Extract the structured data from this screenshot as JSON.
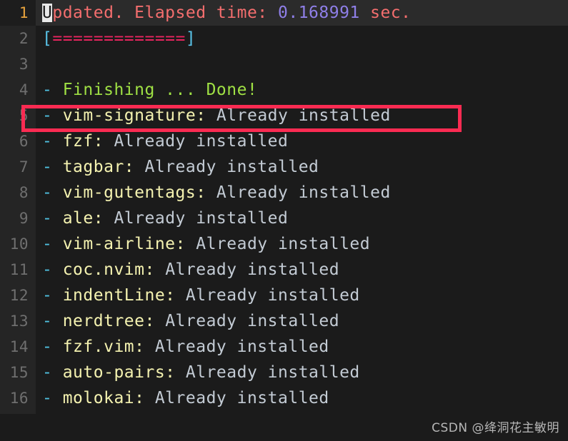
{
  "terminal": {
    "background_color": "#1b1b1b",
    "gutter_color": "#252525",
    "current_line_color": "#2b2b2b"
  },
  "colors": {
    "message": "#f46e6e",
    "number": "#8f7fe8",
    "bracket": "#59c3e8",
    "equals": "#e8255f",
    "dash": "#4fc1e0",
    "done": "#9fe044",
    "plugin": "#f4f2b0",
    "status": "#c3cbd4",
    "line_number": "#6f6f6f",
    "current_line_number": "#e8a33d",
    "cursor": "#e9e9e9",
    "highlight_box": "#fb2b52"
  },
  "lines": [
    {
      "number": "1",
      "current": true,
      "segments": [
        {
          "text": "U",
          "style": "cursor"
        },
        {
          "text": "pdated. Elapsed time: ",
          "style": "c-msg"
        },
        {
          "text": "0.168991",
          "style": "c-num"
        },
        {
          "text": " sec.",
          "style": "c-msg"
        }
      ]
    },
    {
      "number": "2",
      "current": false,
      "segments": [
        {
          "text": "[",
          "style": "c-bracket"
        },
        {
          "text": "=============",
          "style": "c-eq"
        },
        {
          "text": "]",
          "style": "c-bracket"
        }
      ]
    },
    {
      "number": "3",
      "current": false,
      "segments": []
    },
    {
      "number": "4",
      "current": false,
      "segments": [
        {
          "text": "-",
          "style": "c-dash"
        },
        {
          "text": " Finishing ... Done!",
          "style": "c-done"
        }
      ]
    },
    {
      "number": "5",
      "current": false,
      "segments": [
        {
          "text": "-",
          "style": "c-dash"
        },
        {
          "text": " vim-signature:",
          "style": "c-plugin"
        },
        {
          "text": " Already installed",
          "style": "c-status"
        }
      ]
    },
    {
      "number": "6",
      "current": false,
      "segments": [
        {
          "text": "-",
          "style": "c-dash"
        },
        {
          "text": " fzf:",
          "style": "c-plugin"
        },
        {
          "text": " Already installed",
          "style": "c-status"
        }
      ]
    },
    {
      "number": "7",
      "current": false,
      "segments": [
        {
          "text": "-",
          "style": "c-dash"
        },
        {
          "text": " tagbar:",
          "style": "c-plugin"
        },
        {
          "text": " Already installed",
          "style": "c-status"
        }
      ]
    },
    {
      "number": "8",
      "current": false,
      "segments": [
        {
          "text": "-",
          "style": "c-dash"
        },
        {
          "text": " vim-gutentags:",
          "style": "c-plugin"
        },
        {
          "text": " Already installed",
          "style": "c-status"
        }
      ]
    },
    {
      "number": "9",
      "current": false,
      "segments": [
        {
          "text": "-",
          "style": "c-dash"
        },
        {
          "text": " ale:",
          "style": "c-plugin"
        },
        {
          "text": " Already installed",
          "style": "c-status"
        }
      ]
    },
    {
      "number": "10",
      "current": false,
      "segments": [
        {
          "text": "-",
          "style": "c-dash"
        },
        {
          "text": " vim-airline:",
          "style": "c-plugin"
        },
        {
          "text": " Already installed",
          "style": "c-status"
        }
      ]
    },
    {
      "number": "11",
      "current": false,
      "segments": [
        {
          "text": "-",
          "style": "c-dash"
        },
        {
          "text": " coc.nvim:",
          "style": "c-plugin"
        },
        {
          "text": " Already installed",
          "style": "c-status"
        }
      ]
    },
    {
      "number": "12",
      "current": false,
      "segments": [
        {
          "text": "-",
          "style": "c-dash"
        },
        {
          "text": " indentLine:",
          "style": "c-plugin"
        },
        {
          "text": " Already installed",
          "style": "c-status"
        }
      ]
    },
    {
      "number": "13",
      "current": false,
      "segments": [
        {
          "text": "-",
          "style": "c-dash"
        },
        {
          "text": " nerdtree:",
          "style": "c-plugin"
        },
        {
          "text": " Already installed",
          "style": "c-status"
        }
      ]
    },
    {
      "number": "14",
      "current": false,
      "segments": [
        {
          "text": "-",
          "style": "c-dash"
        },
        {
          "text": " fzf.vim:",
          "style": "c-plugin"
        },
        {
          "text": " Already installed",
          "style": "c-status"
        }
      ]
    },
    {
      "number": "15",
      "current": false,
      "segments": [
        {
          "text": "-",
          "style": "c-dash"
        },
        {
          "text": " auto-pairs:",
          "style": "c-plugin"
        },
        {
          "text": " Already installed",
          "style": "c-status"
        }
      ]
    },
    {
      "number": "16",
      "current": false,
      "segments": [
        {
          "text": "-",
          "style": "c-dash"
        },
        {
          "text": " molokai:",
          "style": "c-plugin"
        },
        {
          "text": " Already installed",
          "style": "c-status"
        }
      ]
    }
  ],
  "annotation": {
    "target_line": "5",
    "target_text": "- vim-signature: Already installed"
  },
  "watermark": {
    "text": "CSDN @绛洞花主敏明"
  }
}
